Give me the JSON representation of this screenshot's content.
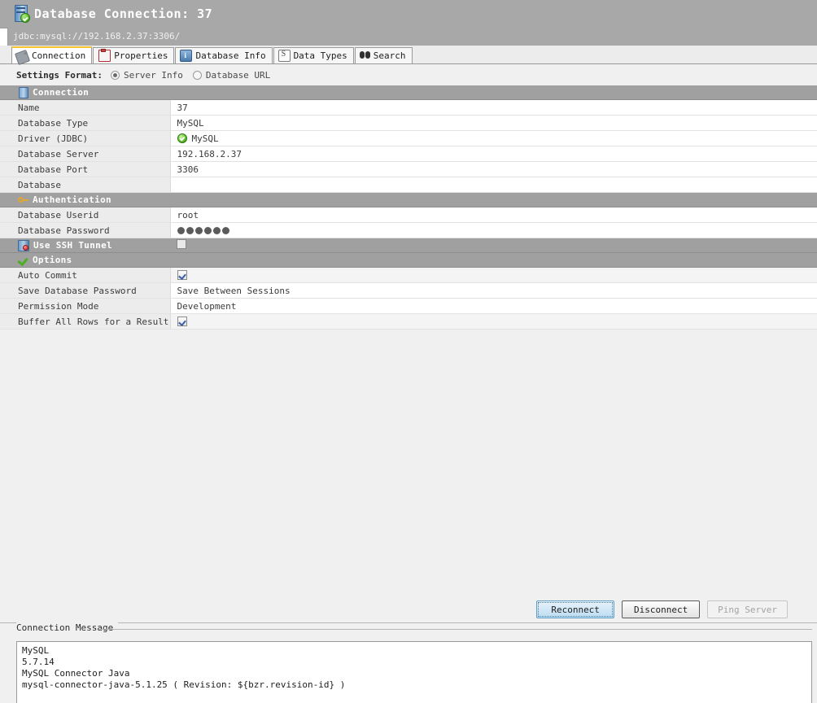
{
  "window": {
    "title": "Database Connection: 37",
    "icon": "database-server-connected-icon",
    "url": "jdbc:mysql://192.168.2.37:3306/"
  },
  "tabs": [
    {
      "label": "Connection",
      "icon": "plug-icon",
      "active": true
    },
    {
      "label": "Properties",
      "icon": "clipboard-icon",
      "active": false
    },
    {
      "label": "Database Info",
      "icon": "database-info-icon",
      "active": false
    },
    {
      "label": "Data Types",
      "icon": "data-types-icon",
      "active": false
    },
    {
      "label": "Search",
      "icon": "binoculars-icon",
      "active": false
    }
  ],
  "settings_format": {
    "label": "Settings Format:",
    "options": [
      {
        "label": "Server Info",
        "selected": true
      },
      {
        "label": "Database URL",
        "selected": false
      }
    ]
  },
  "groups": {
    "connection": {
      "title": "Connection",
      "icon": "connection-book-icon"
    },
    "authentication": {
      "title": "Authentication",
      "icon": "key-icon"
    },
    "ssh": {
      "title": "Use SSH Tunnel",
      "icon": "ssh-tunnel-icon",
      "checked": false
    },
    "options": {
      "title": "Options",
      "icon": "green-check-icon"
    }
  },
  "rows": {
    "name": {
      "label": "Name",
      "value": "37"
    },
    "db_type": {
      "label": "Database Type",
      "value": "MySQL"
    },
    "driver": {
      "label": "Driver (JDBC)",
      "value": "MySQL",
      "status": "ok"
    },
    "db_server": {
      "label": "Database Server",
      "value": "192.168.2.37"
    },
    "db_port": {
      "label": "Database Port",
      "value": "3306"
    },
    "database": {
      "label": "Database",
      "value": ""
    },
    "db_userid": {
      "label": "Database Userid",
      "value": "root"
    },
    "db_password": {
      "label": "Database Password",
      "value": "••••••",
      "masked_count": 6
    },
    "auto_commit": {
      "label": "Auto Commit",
      "checked": true
    },
    "save_password": {
      "label": "Save Database Password",
      "value": "Save Between Sessions"
    },
    "permission_mode": {
      "label": "Permission Mode",
      "value": "Development"
    },
    "buffer_rows": {
      "label": "Buffer All Rows for a Result",
      "checked": true
    }
  },
  "buttons": {
    "reconnect": {
      "label": "Reconnect",
      "state": "focused"
    },
    "disconnect": {
      "label": "Disconnect",
      "state": "normal"
    },
    "ping_server": {
      "label": "Ping Server",
      "state": "disabled"
    }
  },
  "connection_message": {
    "title": "Connection Message",
    "lines": [
      "MySQL",
      "5.7.14",
      "MySQL Connector Java",
      "mysql-connector-java-5.1.25 ( Revision: ${bzr.revision-id} )"
    ]
  },
  "colors": {
    "titlebar": "#a8a8a8",
    "group_header": "#a0a0a0",
    "active_tab_accent": "#f7c52d",
    "content_bg": "#f0f0f0",
    "label_col": "#ececec",
    "value_col": "#ffffff",
    "driver_ok": "#4caf22",
    "focus_blue": "#5f9ec6"
  }
}
